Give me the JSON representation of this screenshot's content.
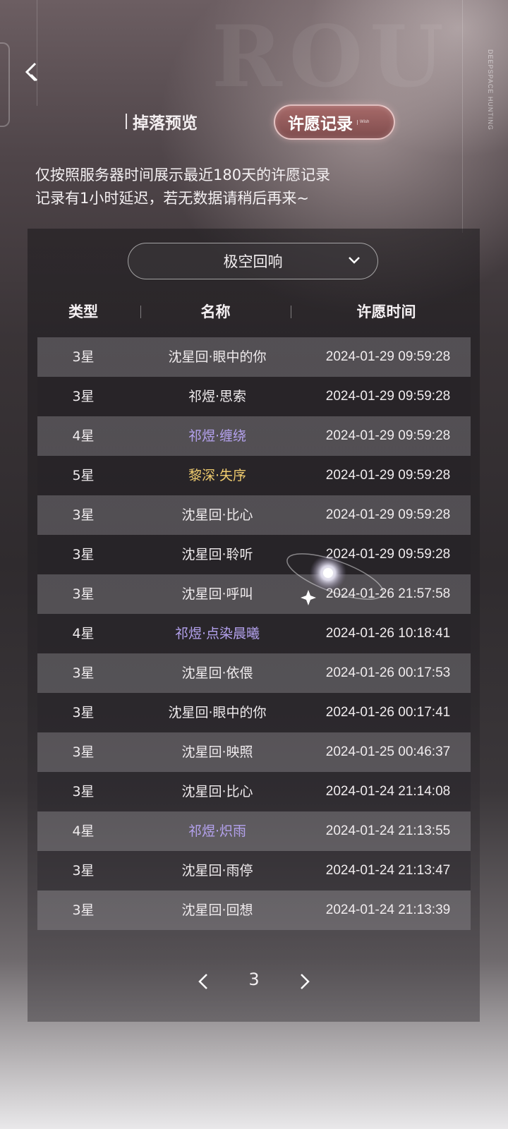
{
  "header": {
    "tab_drop_label": "掉落预览",
    "tab_wish_label": "许愿记录",
    "tab_wish_mini": "Wish",
    "brand_vertical": "DEEPSPACE HUNTING"
  },
  "notice": {
    "line1": "仅按照服务器时间展示最近180天的许愿记录",
    "line2": "记录有1小时延迟，若无数据请稍后再来~"
  },
  "filter": {
    "selected": "极空回响"
  },
  "table": {
    "headers": {
      "type": "类型",
      "name": "名称",
      "time": "许愿时间"
    },
    "rows": [
      {
        "type": "3星",
        "name": "沈星回·眼中的你",
        "time": "2024-01-29 09:59:28",
        "rarity": 3
      },
      {
        "type": "3星",
        "name": "祁煜·思索",
        "time": "2024-01-29 09:59:28",
        "rarity": 3
      },
      {
        "type": "4星",
        "name": "祁煜·缠绕",
        "time": "2024-01-29 09:59:28",
        "rarity": 4
      },
      {
        "type": "5星",
        "name": "黎深·失序",
        "time": "2024-01-29 09:59:28",
        "rarity": 5
      },
      {
        "type": "3星",
        "name": "沈星回·比心",
        "time": "2024-01-29 09:59:28",
        "rarity": 3
      },
      {
        "type": "3星",
        "name": "沈星回·聆听",
        "time": "2024-01-29 09:59:28",
        "rarity": 3
      },
      {
        "type": "3星",
        "name": "沈星回·呼叫",
        "time": "2024-01-26 21:57:58",
        "rarity": 3
      },
      {
        "type": "4星",
        "name": "祁煜·点染晨曦",
        "time": "2024-01-26 10:18:41",
        "rarity": 4
      },
      {
        "type": "3星",
        "name": "沈星回·依偎",
        "time": "2024-01-26 00:17:53",
        "rarity": 3
      },
      {
        "type": "3星",
        "name": "沈星回·眼中的你",
        "time": "2024-01-26 00:17:41",
        "rarity": 3
      },
      {
        "type": "3星",
        "name": "沈星回·映照",
        "time": "2024-01-25 00:46:37",
        "rarity": 3
      },
      {
        "type": "3星",
        "name": "沈星回·比心",
        "time": "2024-01-24 21:14:08",
        "rarity": 3
      },
      {
        "type": "4星",
        "name": "祁煜·炽雨",
        "time": "2024-01-24 21:13:55",
        "rarity": 4
      },
      {
        "type": "3星",
        "name": "沈星回·雨停",
        "time": "2024-01-24 21:13:47",
        "rarity": 3
      },
      {
        "type": "3星",
        "name": "沈星回·回想",
        "time": "2024-01-24 21:13:39",
        "rarity": 3
      }
    ]
  },
  "pager": {
    "page": "3"
  },
  "colors": {
    "rarity4": "#b4a2ee",
    "rarity5": "#efcb6e",
    "accent": "#a76a69"
  },
  "icons": [
    "back-arrow-icon",
    "chevron-down-icon",
    "prev-page-icon",
    "next-page-icon"
  ]
}
